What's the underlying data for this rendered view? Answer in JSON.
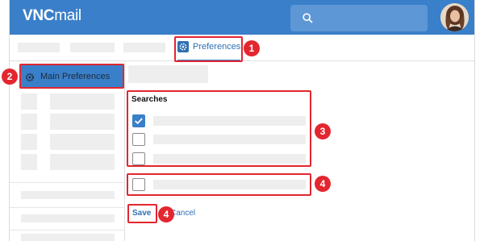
{
  "app": {
    "brand_bold": "VNC",
    "brand_light": "mail"
  },
  "tabs": {
    "active_label": "Preferences"
  },
  "sidebar": {
    "active_label": "Main Preferences"
  },
  "content": {
    "section_title": "Searches",
    "checkboxes": [
      true,
      false,
      false,
      false
    ],
    "save_label": "Save",
    "cancel_label": "Cancel"
  },
  "annotations": [
    "1",
    "2",
    "3",
    "4",
    "4"
  ],
  "colors": {
    "topbar": "#3a7fc9",
    "highlight": "#e3262f",
    "link": "#2f6fb4"
  },
  "icons": [
    "search-icon",
    "gear-icon",
    "checkmark-icon"
  ]
}
